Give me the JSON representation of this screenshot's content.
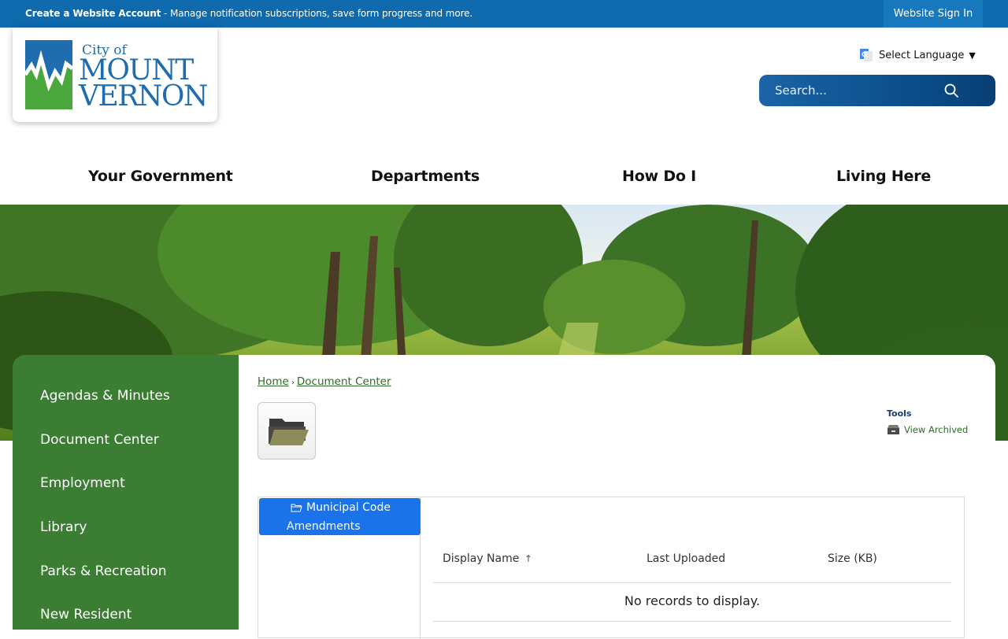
{
  "topbar": {
    "create_account": "Create a Website Account",
    "create_account_desc": " - Manage notification subscriptions, save form progress and more.",
    "sign_in": "Website Sign In"
  },
  "logo": {
    "line1": "City of",
    "line2": "MOUNT",
    "line3": "VERNON",
    "colors": {
      "blue": "#1f6cae",
      "green": "#4aa83c"
    }
  },
  "language": {
    "label": "Select Language",
    "icon": "google-translate-icon"
  },
  "search": {
    "placeholder": "Search...",
    "icon": "search-icon"
  },
  "nav": [
    "Your Government",
    "Departments",
    "How Do I",
    "Living Here"
  ],
  "sidebar": {
    "items": [
      "Agendas & Minutes",
      "Document Center",
      "Employment",
      "Library",
      "Parks & Recreation",
      "New Resident"
    ]
  },
  "breadcrumb": {
    "home": "Home",
    "sep": "›",
    "current": "Document Center"
  },
  "tools": {
    "title": "Tools",
    "view_archived": "View Archived"
  },
  "document_center": {
    "selected_folder_line1": "Municipal Code",
    "selected_folder_line2": "Amendments",
    "columns": [
      "Display Name",
      "Last Uploaded",
      "Size (KB)"
    ],
    "sort_indicator": "↑",
    "empty_message": "No records to display."
  },
  "colors": {
    "topbar": "#0e6aad",
    "sidebar": "#3a7d33",
    "link": "#2e6a2a",
    "selected_folder": "#1a73e8"
  }
}
